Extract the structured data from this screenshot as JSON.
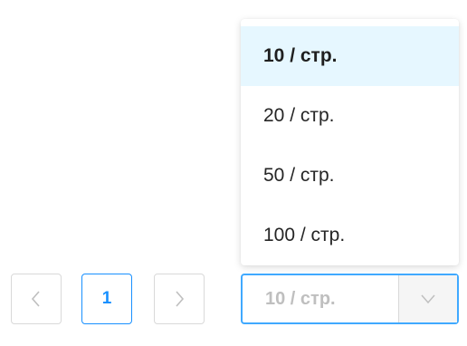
{
  "dropdown": {
    "options": [
      {
        "label": "10 / стр.",
        "selected": true
      },
      {
        "label": "20 / стр.",
        "selected": false
      },
      {
        "label": "50 / стр.",
        "selected": false
      },
      {
        "label": "100 / стр.",
        "selected": false
      }
    ]
  },
  "pagination": {
    "prev_icon": "chevron-left-icon",
    "current_page": "1",
    "next_icon": "chevron-right-icon",
    "page_size_value": "10 / стр.",
    "select_icon": "chevron-down-icon"
  },
  "colors": {
    "accent": "#1890ff",
    "selected_bg": "#e6f7ff",
    "disabled_text": "#bfbfbf",
    "border": "#d9d9d9"
  }
}
